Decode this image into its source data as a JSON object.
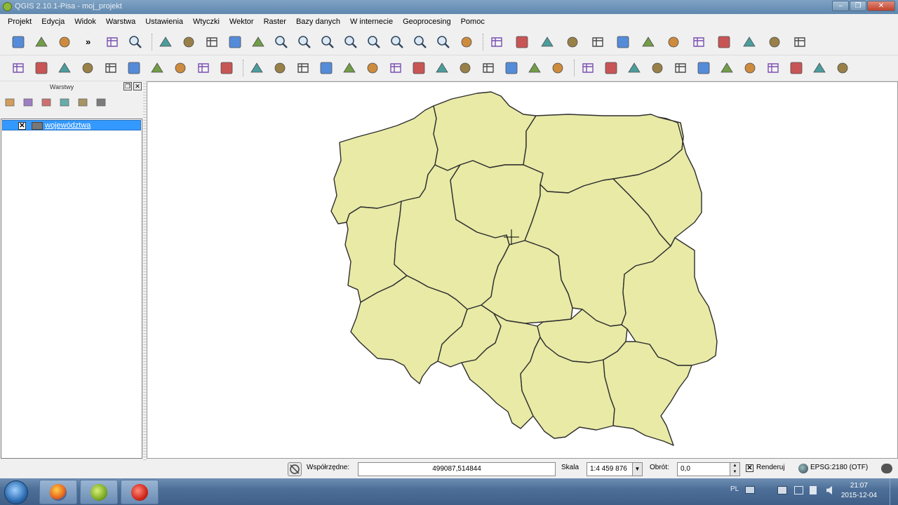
{
  "window": {
    "title": "QGIS 2.10.1-Pisa - moj_projekt",
    "minimize_label": "–",
    "restore_label": "❐",
    "close_label": "✕"
  },
  "menu": [
    "Projekt",
    "Edycja",
    "Widok",
    "Warstwa",
    "Ustawienia",
    "Wtyczki",
    "Wektor",
    "Raster",
    "Bazy danych",
    "W internecie",
    "Geoprocesing",
    "Pomoc"
  ],
  "toolbar1": {
    "overflow_label": "»",
    "icons": [
      "new-project-icon",
      "open-project-icon",
      "save-project-icon",
      "pan-to-selection-icon",
      "touch-zoom-icon",
      "pan-map-icon",
      "identify-map-icon",
      "select-pan-icon",
      "pan-icon",
      "pan-to-selected-icon",
      "zoom-in-icon",
      "zoom-out-icon",
      "zoom-actual-icon",
      "zoom-full-icon",
      "zoom-to-selection-icon",
      "zoom-to-layer-icon",
      "zoom-last-icon",
      "zoom-next-icon",
      "refresh-icon",
      "identify-icon",
      "select-features-icon",
      "select-by-value-icon",
      "deselect-icon",
      "expression-select-icon",
      "attribute-table-icon",
      "field-calculator-icon",
      "statistics-icon",
      "measure-icon",
      "map-tips-icon",
      "new-bookmark-icon",
      "show-bookmarks-icon",
      "text-annotation-icon"
    ]
  },
  "toolbar2": {
    "icons": [
      "current-edits-icon",
      "toggle-editing-icon",
      "save-edits-icon",
      "add-feature-icon",
      "move-feature-icon",
      "node-tool-icon",
      "delete-selected-icon",
      "cut-features-icon",
      "copy-features-icon",
      "paste-features-icon",
      "add-vector-layer-icon",
      "add-raster-layer-icon",
      "add-postgis-layer-icon",
      "add-spatialite-layer-icon",
      "add-mssql-layer-icon",
      "add-oracle-layer-icon",
      "add-wms-layer-icon",
      "add-wcs-layer-icon",
      "add-wfs-layer-icon",
      "add-delimited-layer-icon",
      "new-shapefile-icon",
      "new-spatialite-icon",
      "new-temp-layer-icon",
      "create-grid-icon",
      "rotate-label-icon",
      "highlight-label-icon",
      "pin-labels-icon",
      "show-hide-labels-icon",
      "move-label-icon",
      "rotate-point-icon",
      "offset-point-icon",
      "digitizing-icon",
      "snap-icon",
      "measure-bearing-icon",
      "rubber-band-icon",
      "sum-icon"
    ]
  },
  "layers_panel": {
    "title": "Warstwy",
    "float_label": "❐",
    "close_label": "✕",
    "tools": [
      "open-layer-styling-icon",
      "manage-visibility-icon",
      "filter-legend-icon",
      "expand-all-icon",
      "collapse-all-icon",
      "remove-layer-icon"
    ],
    "layers": [
      {
        "name": "województwa",
        "checked": true,
        "check_mark": "✕",
        "selected": true
      }
    ]
  },
  "map": {
    "fill_color": "#e8eaa6",
    "border_color": "#2e2e2e",
    "cursor": "crosshair"
  },
  "statusbar": {
    "coord_label": "Współrzędne:",
    "coord_value": "499087,514844",
    "scale_label": "Skala",
    "scale_value": "1:4 459 876",
    "rotation_label": "Obrót:",
    "rotation_value": "0,0",
    "render_label": "Renderuj",
    "render_checked": true,
    "render_mark": "✕",
    "crs_label": "EPSG:2180 (OTF)"
  },
  "taskbar": {
    "lang": "PL",
    "time": "21:07",
    "date": "2015-12-04",
    "apps": [
      "firefox-icon",
      "qgis-icon",
      "recorder-icon"
    ]
  }
}
